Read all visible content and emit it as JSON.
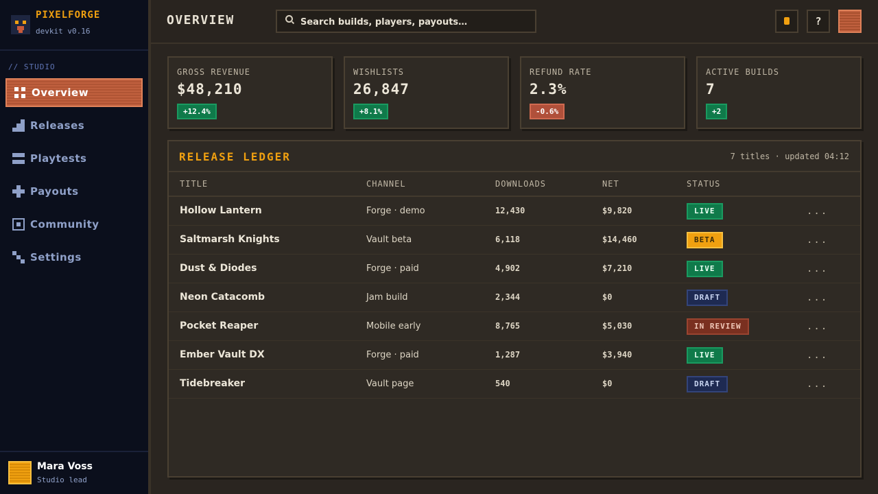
{
  "brand": {
    "name": "PIXELFORGE",
    "version": "devkit v0.16"
  },
  "sidebar": {
    "section_label": "// STUDIO",
    "items": [
      {
        "label": "Overview",
        "icon": "grid-icon",
        "active": true
      },
      {
        "label": "Releases",
        "icon": "stairs-icon",
        "active": false
      },
      {
        "label": "Playtests",
        "icon": "stack-icon",
        "active": false
      },
      {
        "label": "Payouts",
        "icon": "plus-icon",
        "active": false
      },
      {
        "label": "Community",
        "icon": "square-icon",
        "active": false
      },
      {
        "label": "Settings",
        "icon": "diagonal-icon",
        "active": false
      }
    ],
    "user": {
      "name": "Mara Voss",
      "role": "Studio lead"
    }
  },
  "header": {
    "title": "OVERVIEW",
    "search_placeholder": "Search builds, players, payouts…",
    "help_glyph": "?"
  },
  "stats": [
    {
      "label": "GROSS REVENUE",
      "value": "$48,210",
      "delta": "+12.4%",
      "trend": "up"
    },
    {
      "label": "WISHLISTS",
      "value": "26,847",
      "delta": "+8.1%",
      "trend": "up"
    },
    {
      "label": "REFUND RATE",
      "value": "2.3%",
      "delta": "-0.6%",
      "trend": "down"
    },
    {
      "label": "ACTIVE BUILDS",
      "value": "7",
      "delta": "+2",
      "trend": "up"
    }
  ],
  "ledger": {
    "title": "RELEASE LEDGER",
    "meta": "7 titles · updated 04:12",
    "columns": [
      "TITLE",
      "CHANNEL",
      "DOWNLOADS",
      "NET",
      "STATUS"
    ],
    "rows": [
      {
        "title": "Hollow Lantern",
        "channel": "Forge · demo",
        "downloads": "12,430",
        "net": "$9,820",
        "status": "LIVE",
        "status_type": "live"
      },
      {
        "title": "Saltmarsh Knights",
        "channel": "Vault beta",
        "downloads": "6,118",
        "net": "$14,460",
        "status": "BETA",
        "status_type": "beta"
      },
      {
        "title": "Dust & Diodes",
        "channel": "Forge · paid",
        "downloads": "4,902",
        "net": "$7,210",
        "status": "LIVE",
        "status_type": "live"
      },
      {
        "title": "Neon Catacomb",
        "channel": "Jam build",
        "downloads": "2,344",
        "net": "$0",
        "status": "DRAFT",
        "status_type": "draft"
      },
      {
        "title": "Pocket Reaper",
        "channel": "Mobile early",
        "downloads": "8,765",
        "net": "$5,030",
        "status": "IN REVIEW",
        "status_type": "review"
      },
      {
        "title": "Ember Vault DX",
        "channel": "Forge · paid",
        "downloads": "1,287",
        "net": "$3,940",
        "status": "LIVE",
        "status_type": "live"
      },
      {
        "title": "Tidebreaker",
        "channel": "Vault page",
        "downloads": "540",
        "net": "$0",
        "status": "DRAFT",
        "status_type": "draft"
      }
    ],
    "row_action": "..."
  },
  "colors": {
    "accent": "#f0a010",
    "active_nav": "#c0603e",
    "live": "#0f7a4a",
    "beta": "#f0a010",
    "draft": "#1e2a52",
    "review": "#7a3020",
    "sidebar_bg": "#0b0f1c",
    "main_bg": "#2a2520"
  }
}
